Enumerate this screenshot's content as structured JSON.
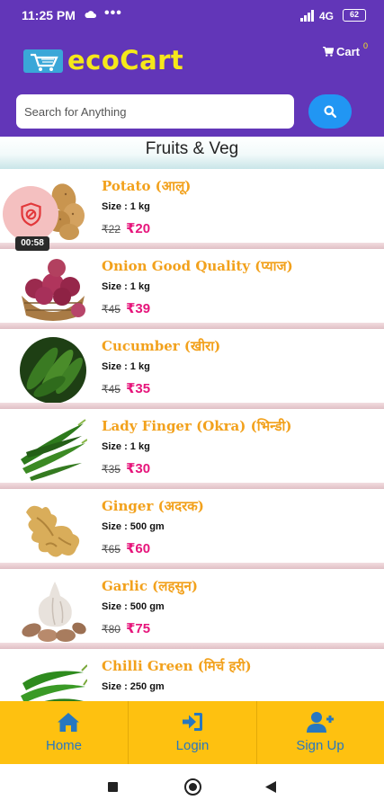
{
  "status_bar": {
    "time": "11:25 PM",
    "dots": "•••",
    "network": "4G",
    "battery": "62"
  },
  "header": {
    "logo_text": "ecoCart",
    "logo_icon": "shopping-cart-logo-icon",
    "cart_label": "Cart",
    "cart_count": "0",
    "cart_icon": "cart-icon"
  },
  "search": {
    "placeholder": "Search for Anything",
    "value": "",
    "icon": "search-icon"
  },
  "category": {
    "title": "Fruits & Veg"
  },
  "products": [
    {
      "name": "Potato (आलू)",
      "size": "Size : 1 kg",
      "mrp": "₹22",
      "price": "₹20",
      "image": "potato-image"
    },
    {
      "name": "Onion Good Quality (प्याज)",
      "size": "Size : 1 kg",
      "mrp": "₹45",
      "price": "₹39",
      "image": "onion-image"
    },
    {
      "name": "Cucumber (खीरा)",
      "size": "Size : 1 kg",
      "mrp": "₹45",
      "price": "₹35",
      "image": "cucumber-image"
    },
    {
      "name": "Lady Finger (Okra) (भिन्डी)",
      "size": "Size : 1 kg",
      "mrp": "₹35",
      "price": "₹30",
      "image": "okra-image"
    },
    {
      "name": "Ginger (अदरक)",
      "size": "Size : 500 gm",
      "mrp": "₹65",
      "price": "₹60",
      "image": "ginger-image"
    },
    {
      "name": "Garlic (लहसुन)",
      "size": "Size : 500 gm",
      "mrp": "₹80",
      "price": "₹75",
      "image": "garlic-image"
    },
    {
      "name": "Chilli Green (मिर्च हरी)",
      "size": "Size : 250 gm",
      "mrp": "",
      "price": "",
      "image": "green-chilli-image"
    }
  ],
  "floating_widget": {
    "icon": "shield-off-icon",
    "timer": "00:58"
  },
  "bottom_nav": [
    {
      "label": "Home",
      "icon": "home-icon"
    },
    {
      "label": "Login",
      "icon": "login-icon"
    },
    {
      "label": "Sign Up",
      "icon": "user-plus-icon"
    }
  ],
  "colors": {
    "primary": "#6236b8",
    "logo_yellow": "#f6e81a",
    "search_button": "#2196f3",
    "product_name": "#f2a11c",
    "price": "#e6157b",
    "bottom_nav_bg": "#fec110",
    "bottom_nav_text": "#2777c0"
  }
}
